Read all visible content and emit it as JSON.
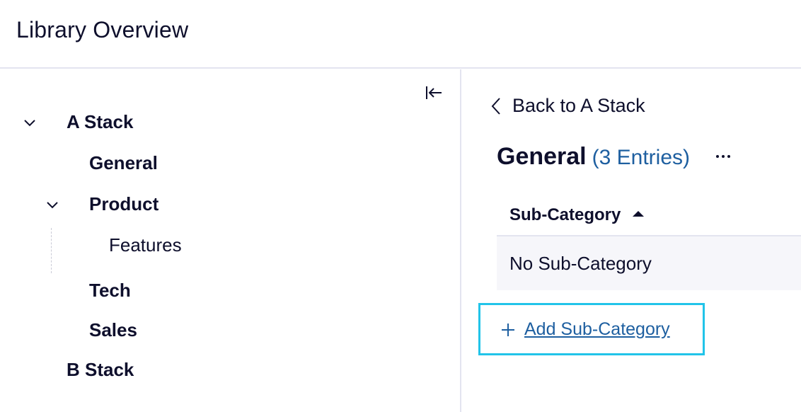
{
  "header": {
    "title": "Library Overview"
  },
  "tree": {
    "collapse_icon": "collapse-panel-icon",
    "items": [
      {
        "label": "A Stack",
        "expanded": true
      },
      {
        "label": "General"
      },
      {
        "label": "Product",
        "expanded": true
      },
      {
        "label": "Features"
      },
      {
        "label": "Tech"
      },
      {
        "label": "Sales"
      },
      {
        "label": "B Stack"
      }
    ]
  },
  "detail": {
    "back_label": "Back to A Stack",
    "title": "General",
    "entries_label": "(3 Entries)",
    "table": {
      "column_header": "Sub-Category",
      "sort": "ascending",
      "rows": [
        {
          "sub_category": "No Sub-Category"
        }
      ]
    },
    "add_label": "Add Sub-Category"
  },
  "colors": {
    "text": "#0e0f2c",
    "link": "#1e5fa0",
    "highlight": "#21c4e9",
    "divider": "#e3e4f0",
    "row_bg": "#f6f6fa"
  }
}
